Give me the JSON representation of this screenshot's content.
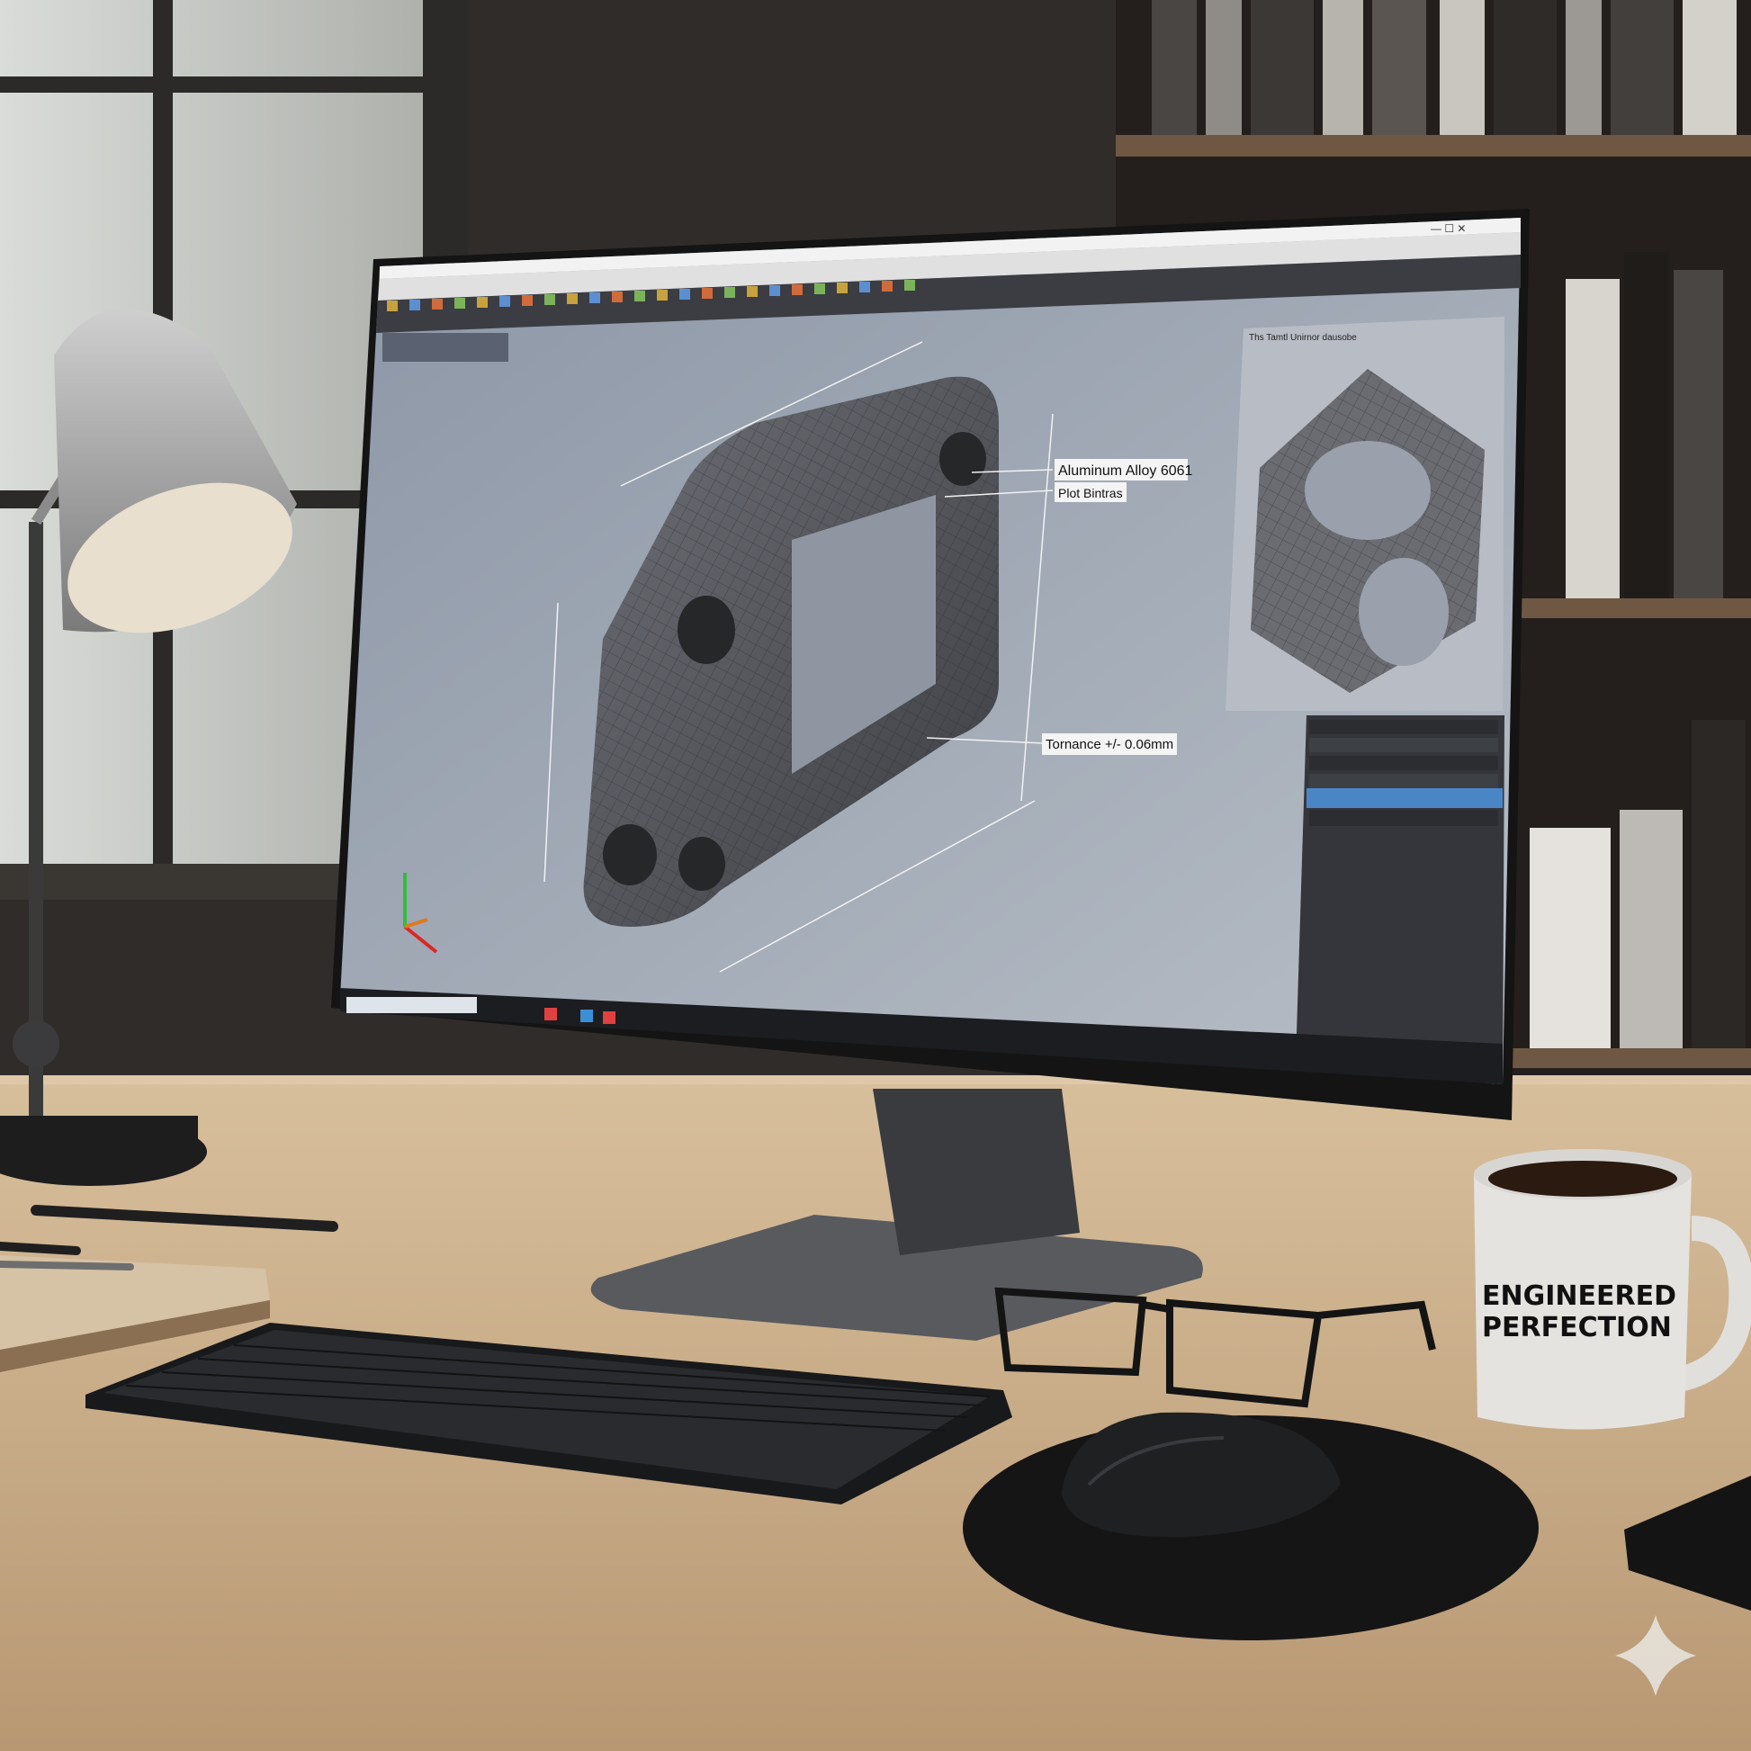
{
  "cad": {
    "callouts": {
      "material": "Aluminum Alloy 6061",
      "secondary": "Plot Bintras",
      "tolerance": "Tornance +/- 0.06mm"
    },
    "panel_title": "Ths Tamtl Unirnor dausobe"
  },
  "mug": {
    "line1": "ENGINEERED",
    "line2": "PERFECTION"
  },
  "colors": {
    "viewport": "#9ea6b2",
    "selection": "#4a86c6",
    "desk": "#c9ab84",
    "wall": "#2e2b29"
  }
}
